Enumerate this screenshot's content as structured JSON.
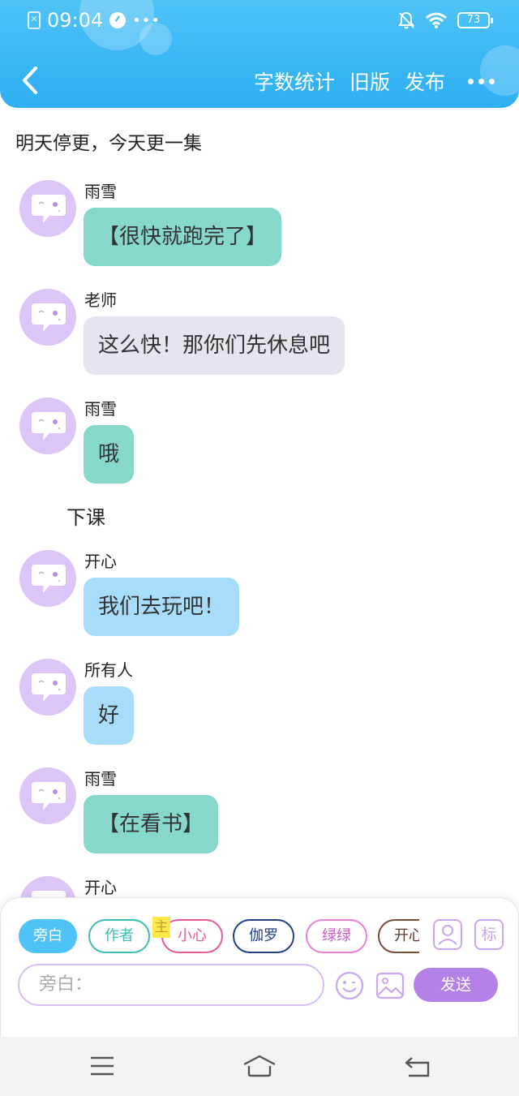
{
  "status_bar": {
    "time": "09:04",
    "battery": "73"
  },
  "nav": {
    "actions": [
      "字数统计",
      "旧版",
      "发布"
    ]
  },
  "scene_title": "明天停更，今天更一集",
  "messages": [
    {
      "sender": "雨雪",
      "text": "【很快就跑完了】",
      "style": "teal"
    },
    {
      "sender": "老师",
      "text": "这么快！那你们先休息吧",
      "style": "gray"
    },
    {
      "sender": "雨雪",
      "text": "哦",
      "style": "teal"
    },
    {
      "sender": "开心",
      "text": "我们去玩吧！",
      "style": "blue"
    },
    {
      "sender": "所有人",
      "text": "好",
      "style": "blue"
    },
    {
      "sender": "雨雪",
      "text": "【在看书】",
      "style": "teal"
    },
    {
      "sender": "开心",
      "text": "",
      "style": "blue"
    }
  ],
  "narration": "下课",
  "composer": {
    "chips": [
      "旁白",
      "作者",
      "小心",
      "伽罗",
      "绿绿",
      "开心"
    ],
    "main_tag": "主",
    "mark_label": "标",
    "input_placeholder": "旁白：",
    "send_label": "发送"
  },
  "colors": {
    "header": "#38b6f5",
    "avatar": "#ddc6f7",
    "bubble_teal": "#86d8cd",
    "bubble_gray": "#e3e6ee",
    "bubble_blue": "#a8dcfb",
    "send": "#b381e8"
  },
  "icons": [
    "back-arrow-icon",
    "more-dots-icon",
    "character-icon",
    "mark-icon",
    "emoji-icon",
    "image-icon",
    "menu-icon",
    "home-icon",
    "return-icon"
  ]
}
